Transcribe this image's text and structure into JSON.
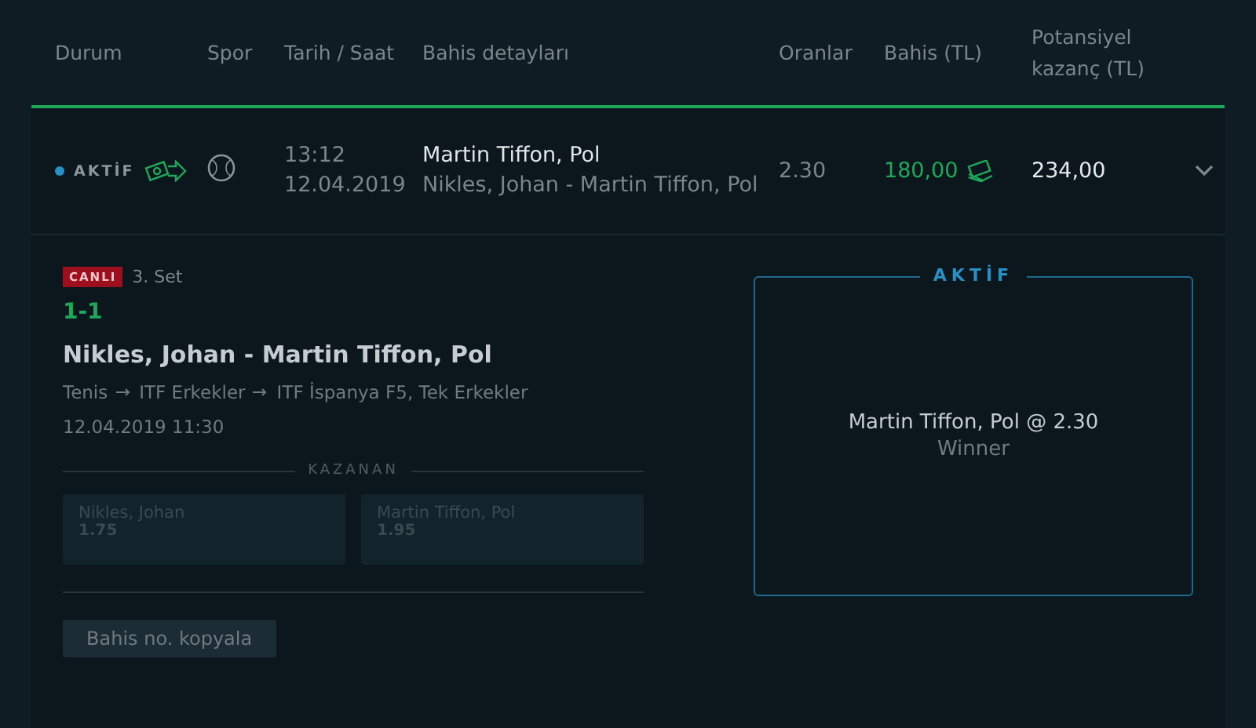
{
  "columns": [
    "Durum",
    "Spor",
    "Tarih / Saat",
    "Bahis detayları",
    "Oranlar",
    "Bahis (TL)",
    "Potansiyel kazanç (TL)"
  ],
  "bet": {
    "status": "AKTİF",
    "time": "13:12",
    "date": "12.04.2019",
    "selection": "Martin Tiffon, Pol",
    "match": "Nikles, Johan - Martin Tiffon, Pol",
    "odds": "2.30",
    "stake": "180,00",
    "potential": "234,00",
    "expanded": true
  },
  "details": {
    "live_badge": "CANLI",
    "period": "3. Set",
    "score": "1-1",
    "match": "Nikles, Johan - Martin Tiffon, Pol",
    "path": [
      "Tenis",
      "ITF Erkekler",
      "ITF İspanya F5, Tek Erkekler"
    ],
    "start": "12.04.2019 11:30",
    "market": "KAZANAN",
    "options": [
      {
        "name": "Nikles, Johan",
        "odds": "1.75",
        "disabled": true
      },
      {
        "name": "Martin Tiffon, Pol",
        "odds": "1.95",
        "disabled": true
      }
    ],
    "copy_button": "Bahis no. kopyala"
  },
  "status_box": {
    "title": "AKTİF",
    "selection": "Martin Tiffon, Pol @ 2.30",
    "market": "Winner"
  }
}
